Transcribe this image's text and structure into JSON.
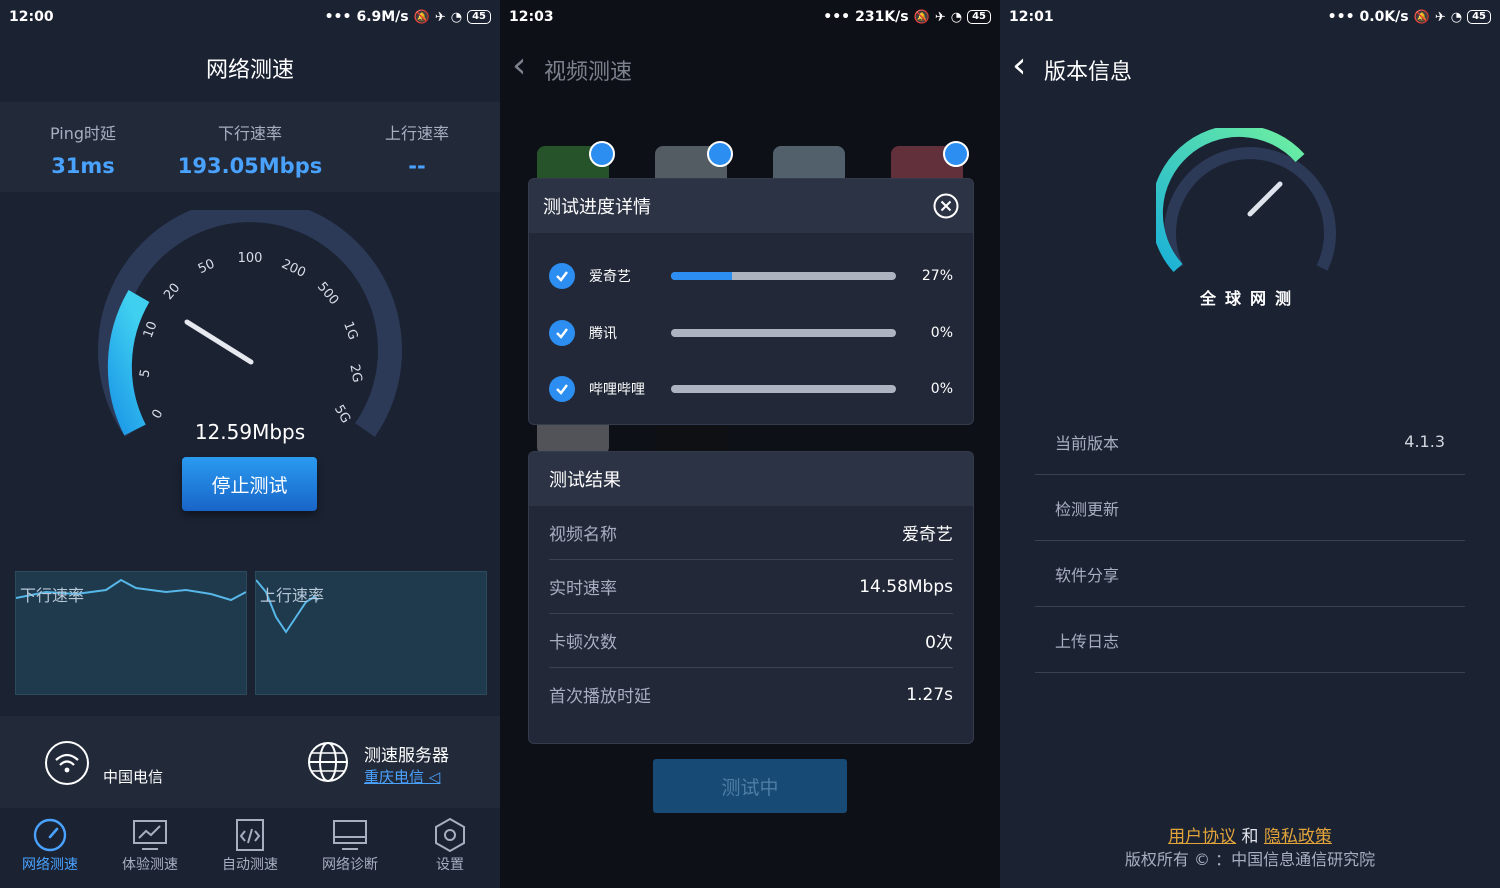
{
  "screen1": {
    "status": {
      "time": "12:00",
      "speed": "6.9M/s",
      "battery": "45"
    },
    "title": "网络测速",
    "stats": [
      {
        "label": "Ping时延",
        "value": "31ms"
      },
      {
        "label": "下行速率",
        "value": "193.05Mbps"
      },
      {
        "label": "上行速率",
        "value": "--"
      }
    ],
    "gauge": {
      "ticks": [
        "0",
        "5",
        "10",
        "20",
        "50",
        "100",
        "200",
        "500",
        "1G",
        "2G",
        "5G"
      ],
      "reading": "12.59Mbps"
    },
    "stop_button": "停止测试",
    "graphs": {
      "down_label": "下行速率",
      "up_label": "上行速率"
    },
    "network": {
      "isp": "中国电信",
      "server_title": "测速服务器",
      "server_name": "重庆电信"
    },
    "nav": [
      {
        "label": "网络测速",
        "icon": "speedometer-icon",
        "active": true
      },
      {
        "label": "体验测速",
        "icon": "chart-monitor-icon",
        "active": false
      },
      {
        "label": "自动测速",
        "icon": "code-doc-icon",
        "active": false
      },
      {
        "label": "网络诊断",
        "icon": "monitor-icon",
        "active": false
      },
      {
        "label": "设置",
        "icon": "hexagon-gear-icon",
        "active": false
      }
    ]
  },
  "screen2": {
    "status": {
      "time": "12:03",
      "speed": "231K/s",
      "battery": "45"
    },
    "title": "视频测速",
    "progress_card": {
      "title": "测试进度详情",
      "items": [
        {
          "name": "爱奇艺",
          "percent": "27%",
          "fraction": 0.27
        },
        {
          "name": "腾讯",
          "percent": "0%",
          "fraction": 0
        },
        {
          "name": "哔哩哔哩",
          "percent": "0%",
          "fraction": 0
        }
      ]
    },
    "result_card": {
      "title": "测试结果",
      "rows": [
        {
          "key": "视频名称",
          "value": "爱奇艺"
        },
        {
          "key": "实时速率",
          "value": "14.58Mbps"
        },
        {
          "key": "卡顿次数",
          "value": "0次"
        },
        {
          "key": "首次播放时延",
          "value": "1.27s"
        }
      ]
    },
    "testing_button": "测试中"
  },
  "screen3": {
    "status": {
      "time": "12:01",
      "speed": "0.0K/s",
      "battery": "45"
    },
    "title": "版本信息",
    "brand": "全球网测",
    "rows": [
      {
        "label": "当前版本",
        "value": "4.1.3"
      },
      {
        "label": "检测更新",
        "value": ""
      },
      {
        "label": "软件分享",
        "value": ""
      },
      {
        "label": "上传日志",
        "value": ""
      }
    ],
    "links": {
      "agreement": "用户协议",
      "and": "和",
      "privacy": "隐私政策"
    },
    "copyright": "版权所有 © ：中国信息通信研究院"
  },
  "colors": {
    "accent": "#4aa2ff",
    "button": "#1f7fe0",
    "link_orange": "#e2a43a",
    "bg": "#1b2232"
  }
}
